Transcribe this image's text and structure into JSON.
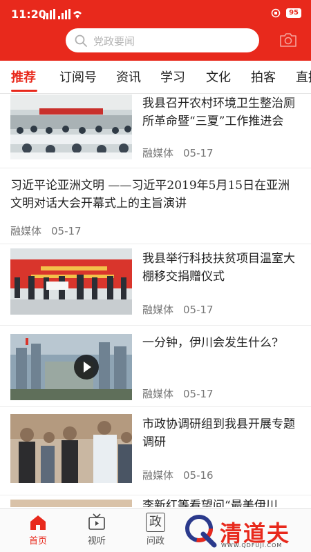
{
  "status_bar": {
    "time": "11:20",
    "battery": "95"
  },
  "search": {
    "placeholder": "党政要闻"
  },
  "tabs": [
    {
      "label": "推荐",
      "active": true
    },
    {
      "label": "订阅号"
    },
    {
      "label": "资讯"
    },
    {
      "label": "学习"
    },
    {
      "label": "文化"
    },
    {
      "label": "拍客"
    },
    {
      "label": "直播"
    }
  ],
  "feed": [
    {
      "title": "我县召开农村环境卫生整治厕所革命暨“三夏”工作推进会",
      "source": "融媒体",
      "date": "05-17",
      "thumb": "meeting-photo"
    },
    {
      "title": "习近平论亚洲文明 ——习近平2019年5月15日在亚洲文明对话大会开幕式上的主旨演讲",
      "source": "融媒体",
      "date": "05-17"
    },
    {
      "title": "我县举行科技扶贫项目温室大棚移交捐赠仪式",
      "source": "融媒体",
      "date": "05-17",
      "thumb": "ceremony-photo"
    },
    {
      "title": "一分钟，伊川会发生什么?",
      "source": "融媒体",
      "date": "05-17",
      "thumb": "city-video",
      "video": true
    },
    {
      "title": "市政协调研组到我县开展专题调研",
      "source": "融媒体",
      "date": "05-16",
      "thumb": "inspection-photo"
    },
    {
      "title": "李新红等看望问“最美伊川",
      "thumb": "partial-photo"
    }
  ],
  "bottom_nav": [
    {
      "label": "首页",
      "icon": "home-icon",
      "active": true
    },
    {
      "label": "视听",
      "icon": "tv-icon"
    },
    {
      "label": "问政",
      "icon": "zheng-icon",
      "glyph": "政"
    }
  ],
  "watermark": {
    "text": "清道夫",
    "url": "WWW.QDFUJI.COM"
  },
  "colors": {
    "brand_red": "#e8291c",
    "text_dark": "#222222",
    "meta_gray": "#777777"
  }
}
